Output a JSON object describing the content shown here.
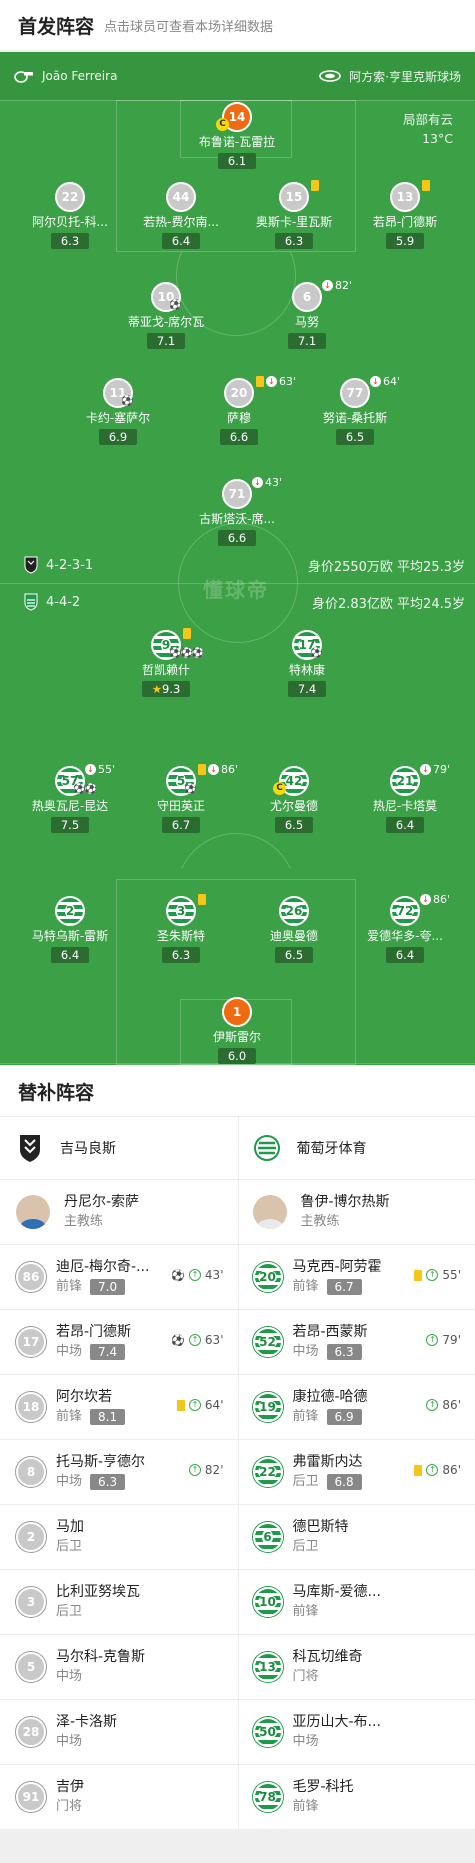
{
  "header": {
    "title": "首发阵容",
    "subtitle": "点击球员可查看本场详细数据"
  },
  "pitch": {
    "referee": "João Ferreira",
    "venue": "阿方索·亨里克斯球场",
    "weather": "局部有云",
    "temperature": "13°C",
    "watermark": "懂球帝",
    "home": {
      "formation": "4-2-3-1",
      "value_info": "身价2550万欧  平均25.3岁"
    },
    "away": {
      "formation": "4-4-2",
      "value_info": "身价2.83亿欧  平均24.5岁"
    }
  },
  "home_players": [
    {
      "num": "14",
      "name": "布鲁诺-瓦雷拉",
      "rating": "6.1",
      "gk": true,
      "captain": true
    },
    {
      "num": "22",
      "name": "阿尔贝托-科...",
      "rating": "6.3"
    },
    {
      "num": "44",
      "name": "若热-费尔南...",
      "rating": "6.4"
    },
    {
      "num": "15",
      "name": "奥斯卡-里瓦斯",
      "rating": "6.3",
      "yellow": true
    },
    {
      "num": "13",
      "name": "若昂-门德斯",
      "rating": "5.9",
      "yellow": true
    },
    {
      "num": "10",
      "name": "蒂亚戈-席尔瓦",
      "rating": "7.1",
      "goals": "⚽"
    },
    {
      "num": "6",
      "name": "马努",
      "rating": "7.1",
      "sub": "82'"
    },
    {
      "num": "11",
      "name": "卡约-塞萨尔",
      "rating": "6.9",
      "goals": "⚽"
    },
    {
      "num": "20",
      "name": "萨穆",
      "rating": "6.6",
      "sub": "63'",
      "yellow": true
    },
    {
      "num": "77",
      "name": "努诺-桑托斯",
      "rating": "6.5",
      "sub": "64'"
    },
    {
      "num": "71",
      "name": "古斯塔沃-席...",
      "rating": "6.6",
      "sub": "43'"
    }
  ],
  "away_players": [
    {
      "num": "9",
      "name": "哲凯赖什",
      "rating": "9.3",
      "yellow": true,
      "goals": "⚽⚽⚽",
      "best": true
    },
    {
      "num": "17",
      "name": "特林康",
      "rating": "7.4",
      "goals": "⚽"
    },
    {
      "num": "57",
      "name": "热奥瓦尼-昆达",
      "rating": "7.5",
      "sub": "55'",
      "goals": "⚽⚽"
    },
    {
      "num": "5",
      "name": "守田英正",
      "rating": "6.7",
      "sub": "86'",
      "yellow": true,
      "goals": "⚽"
    },
    {
      "num": "42",
      "name": "尤尔曼德",
      "rating": "6.5",
      "captain": true
    },
    {
      "num": "21",
      "name": "热尼-卡塔莫",
      "rating": "6.4",
      "sub": "79'"
    },
    {
      "num": "2",
      "name": "马特乌斯-雷斯",
      "rating": "6.4"
    },
    {
      "num": "3",
      "name": "圣朱斯特",
      "rating": "6.3",
      "yellow": true
    },
    {
      "num": "26",
      "name": "迪奥曼德",
      "rating": "6.5"
    },
    {
      "num": "72",
      "name": "爱德华多-夸...",
      "rating": "6.4",
      "sub": "86'"
    },
    {
      "num": "1",
      "name": "伊斯雷尔",
      "rating": "6.0",
      "gk": true
    }
  ],
  "substitutes": {
    "title": "替补阵容",
    "home_team": "吉马良斯",
    "away_team": "葡萄牙体育",
    "home_coach": {
      "name": "丹尼尔-索萨",
      "role": "主教练"
    },
    "away_coach": {
      "name": "鲁伊-博尔热斯",
      "role": "主教练"
    },
    "home": [
      {
        "num": "86",
        "name": "迪厄-梅尔奇-...",
        "pos": "前锋",
        "rating": "7.0",
        "goal": true,
        "in": "43'"
      },
      {
        "num": "17",
        "name": "若昂-门德斯",
        "pos": "中场",
        "rating": "7.4",
        "goal": true,
        "in": "63'"
      },
      {
        "num": "18",
        "name": "阿尔坎若",
        "pos": "前锋",
        "rating": "8.1",
        "yellow": true,
        "in": "64'"
      },
      {
        "num": "8",
        "name": "托马斯-亨德尔",
        "pos": "中场",
        "rating": "6.3",
        "in": "82'"
      },
      {
        "num": "2",
        "name": "马加",
        "pos": "后卫"
      },
      {
        "num": "3",
        "name": "比利亚努埃瓦",
        "pos": "后卫"
      },
      {
        "num": "5",
        "name": "马尔科-克鲁斯",
        "pos": "中场"
      },
      {
        "num": "28",
        "name": "泽-卡洛斯",
        "pos": "中场"
      },
      {
        "num": "91",
        "name": "吉伊",
        "pos": "门将"
      }
    ],
    "away": [
      {
        "num": "20",
        "name": "马克西-阿劳霍",
        "pos": "前锋",
        "rating": "6.7",
        "yellow": true,
        "in": "55'"
      },
      {
        "num": "52",
        "name": "若昂-西蒙斯",
        "pos": "中场",
        "rating": "6.3",
        "in": "79'"
      },
      {
        "num": "19",
        "name": "康拉德-哈德",
        "pos": "前锋",
        "rating": "6.9",
        "in": "86'"
      },
      {
        "num": "22",
        "name": "弗雷斯内达",
        "pos": "后卫",
        "rating": "6.8",
        "yellow": true,
        "in": "86'"
      },
      {
        "num": "6",
        "name": "德巴斯特",
        "pos": "后卫"
      },
      {
        "num": "10",
        "name": "马库斯-爱德...",
        "pos": "前锋"
      },
      {
        "num": "13",
        "name": "科瓦切维奇",
        "pos": "门将"
      },
      {
        "num": "50",
        "name": "亚历山大-布...",
        "pos": "中场"
      },
      {
        "num": "78",
        "name": "毛罗-科托",
        "pos": "前锋"
      }
    ]
  },
  "colors": {
    "pitch": "#3ba046",
    "gk": "#f06a12",
    "home_kit": "#c9c9c9",
    "away_kit": "#1e9a4a",
    "yellow_card": "#f5c518"
  }
}
